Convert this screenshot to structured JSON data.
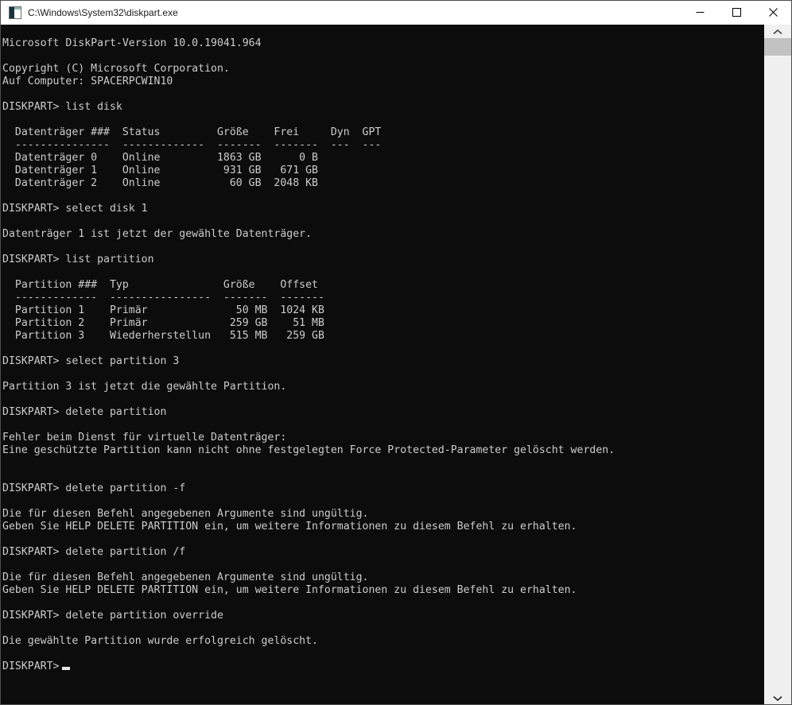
{
  "window": {
    "title": "C:\\Windows\\System32\\diskpart.exe",
    "controls": {
      "minimize": "minimize",
      "maximize": "maximize",
      "close": "close"
    }
  },
  "colors": {
    "console_bg": "#0c0c0c",
    "console_fg": "#cccccc",
    "titlebar_bg": "#ffffff",
    "titlebar_fg": "#1a1a1a",
    "scrollbar_track": "#f0f0f0",
    "scrollbar_thumb": "#c2c2c2",
    "cursor": "#e6e6e6"
  },
  "console": {
    "prompt": "DISKPART>",
    "lines": [
      "",
      "Microsoft DiskPart-Version 10.0.19041.964",
      "",
      "Copyright (C) Microsoft Corporation.",
      "Auf Computer: SPACERPCWIN10",
      "",
      "DISKPART> list disk",
      "",
      "  Datenträger ###  Status         Größe    Frei     Dyn  GPT",
      "  ---------------  -------------  -------  -------  ---  ---",
      "  Datenträger 0    Online         1863 GB      0 B",
      "  Datenträger 1    Online          931 GB   671 GB",
      "  Datenträger 2    Online           60 GB  2048 KB",
      "",
      "DISKPART> select disk 1",
      "",
      "Datenträger 1 ist jetzt der gewählte Datenträger.",
      "",
      "DISKPART> list partition",
      "",
      "  Partition ###  Typ               Größe    Offset",
      "  -------------  ----------------  -------  -------",
      "  Partition 1    Primär              50 MB  1024 KB",
      "  Partition 2    Primär             259 GB    51 MB",
      "  Partition 3    Wiederherstellun   515 MB   259 GB",
      "",
      "DISKPART> select partition 3",
      "",
      "Partition 3 ist jetzt die gewählte Partition.",
      "",
      "DISKPART> delete partition",
      "",
      "Fehler beim Dienst für virtuelle Datenträger:",
      "Eine geschützte Partition kann nicht ohne festgelegten Force Protected-Parameter gelöscht werden.",
      "",
      "",
      "DISKPART> delete partition -f",
      "",
      "Die für diesen Befehl angegebenen Argumente sind ungültig.",
      "Geben Sie HELP DELETE PARTITION ein, um weitere Informationen zu diesem Befehl zu erhalten.",
      "",
      "DISKPART> delete partition /f",
      "",
      "Die für diesen Befehl angegebenen Argumente sind ungültig.",
      "Geben Sie HELP DELETE PARTITION ein, um weitere Informationen zu diesem Befehl zu erhalten.",
      "",
      "DISKPART> delete partition override",
      "",
      "Die gewählte Partition wurde erfolgreich gelöscht.",
      "",
      "DISKPART> "
    ]
  },
  "disk_table": {
    "columns": [
      "Datenträger ###",
      "Status",
      "Größe",
      "Frei",
      "Dyn",
      "GPT"
    ],
    "rows": [
      [
        "Datenträger 0",
        "Online",
        "1863 GB",
        "0 B",
        "",
        ""
      ],
      [
        "Datenträger 1",
        "Online",
        "931 GB",
        "671 GB",
        "",
        ""
      ],
      [
        "Datenträger 2",
        "Online",
        "60 GB",
        "2048 KB",
        "",
        ""
      ]
    ]
  },
  "partition_table": {
    "columns": [
      "Partition ###",
      "Typ",
      "Größe",
      "Offset"
    ],
    "rows": [
      [
        "Partition 1",
        "Primär",
        "50 MB",
        "1024 KB"
      ],
      [
        "Partition 2",
        "Primär",
        "259 GB",
        "51 MB"
      ],
      [
        "Partition 3",
        "Wiederherstellun",
        "515 MB",
        "259 GB"
      ]
    ]
  }
}
